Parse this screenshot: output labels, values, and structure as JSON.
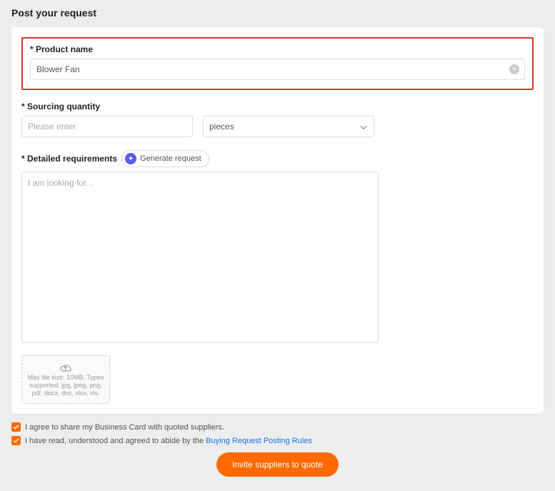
{
  "page": {
    "title": "Post your request"
  },
  "product": {
    "label": "* Product name",
    "value": "Blower Fan"
  },
  "sourcing": {
    "label": "* Sourcing quantity",
    "qty_placeholder": "Please enter",
    "unit_selected": "pieces"
  },
  "requirements": {
    "label": "* Detailed requirements",
    "generate_label": "Generate request",
    "placeholder": "I am looking for..."
  },
  "upload": {
    "hint": "Max file size: 10MB. Types supported: jpg, jpeg, png, pdf, docx, doc, xlsx, xls."
  },
  "agreements": {
    "share_card": "I agree to share my Business Card with quoted suppliers.",
    "rules_prefix": "I have read, understood and agreed to abide by the ",
    "rules_link": "Buying Request Posting Rules"
  },
  "actions": {
    "submit": "Invite suppliers to quote"
  }
}
